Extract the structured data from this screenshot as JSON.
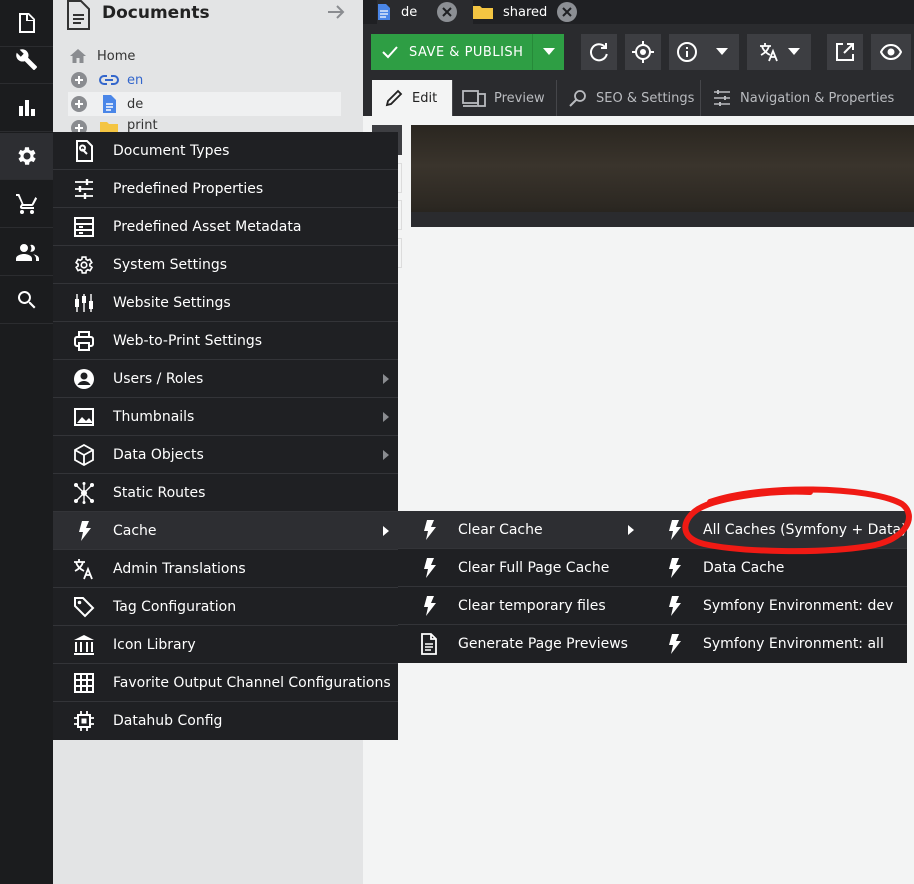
{
  "colors": {
    "rail_bg": "#1b1c1e",
    "menu_bg": "#1f2023",
    "save_green": "#2e9e44",
    "link_blue": "#3366cc",
    "annotation_red": "#f01a14"
  },
  "rail": {
    "icons": [
      "document-icon",
      "wrench-icon",
      "bar-chart-icon",
      "gear-icon",
      "cart-icon",
      "users-icon",
      "search-icon"
    ]
  },
  "tree": {
    "title": "Documents",
    "items": [
      {
        "label": "Home",
        "icon": "home-icon"
      },
      {
        "label": "en",
        "icon": "link-icon"
      },
      {
        "label": "de",
        "icon": "document-icon"
      },
      {
        "label": "print",
        "icon": "folder-icon"
      }
    ]
  },
  "tabs": [
    {
      "label": "de",
      "icon": "document-icon"
    },
    {
      "label": "shared",
      "icon": "folder-icon"
    }
  ],
  "toolbar": {
    "save_label": "SAVE & PUBLISH"
  },
  "subtabs": [
    {
      "label": "Edit",
      "icon": "pencil-icon"
    },
    {
      "label": "Preview",
      "icon": "devices-icon"
    },
    {
      "label": "SEO & Settings",
      "icon": "search-settings-icon"
    },
    {
      "label": "Navigation & Properties",
      "icon": "sliders-icon"
    }
  ],
  "settings_menu": {
    "items": [
      {
        "label": "Document Types",
        "icon": "document-settings-icon",
        "submenu": false
      },
      {
        "label": "Predefined Properties",
        "icon": "sliders-icon",
        "submenu": false
      },
      {
        "label": "Predefined Asset Metadata",
        "icon": "metadata-icon",
        "submenu": false
      },
      {
        "label": "System Settings",
        "icon": "gear-icon",
        "submenu": false
      },
      {
        "label": "Website Settings",
        "icon": "candles-icon",
        "submenu": false
      },
      {
        "label": "Web-to-Print Settings",
        "icon": "printer-icon",
        "submenu": false
      },
      {
        "label": "Users / Roles",
        "icon": "user-circle-icon",
        "submenu": true
      },
      {
        "label": "Thumbnails",
        "icon": "image-icon",
        "submenu": true
      },
      {
        "label": "Data Objects",
        "icon": "cube-icon",
        "submenu": true
      },
      {
        "label": "Static Routes",
        "icon": "network-icon",
        "submenu": false
      },
      {
        "label": "Cache",
        "icon": "flash-icon",
        "submenu": true
      },
      {
        "label": "Admin Translations",
        "icon": "translate-icon",
        "submenu": false
      },
      {
        "label": "Tag Configuration",
        "icon": "tag-icon",
        "submenu": false
      },
      {
        "label": "Icon Library",
        "icon": "library-icon",
        "submenu": false
      },
      {
        "label": "Favorite Output Channel Configurations",
        "icon": "grid-icon",
        "submenu": false
      },
      {
        "label": "Datahub Config",
        "icon": "chip-icon",
        "submenu": false
      }
    ]
  },
  "cache_menu": {
    "items": [
      {
        "label": "Clear Cache",
        "icon": "flash-icon",
        "submenu": true
      },
      {
        "label": "Clear Full Page Cache",
        "icon": "flash-icon",
        "submenu": false
      },
      {
        "label": "Clear temporary files",
        "icon": "flash-icon",
        "submenu": false
      },
      {
        "label": "Generate Page Previews",
        "icon": "document-icon",
        "submenu": false
      }
    ]
  },
  "clear_cache_menu": {
    "items": [
      {
        "label": "All Caches (Symfony + Data)",
        "icon": "flash-icon"
      },
      {
        "label": "Data Cache",
        "icon": "flash-icon"
      },
      {
        "label": "Symfony Environment: dev",
        "icon": "flash-icon"
      },
      {
        "label": "Symfony Environment: all",
        "icon": "flash-icon"
      }
    ]
  }
}
